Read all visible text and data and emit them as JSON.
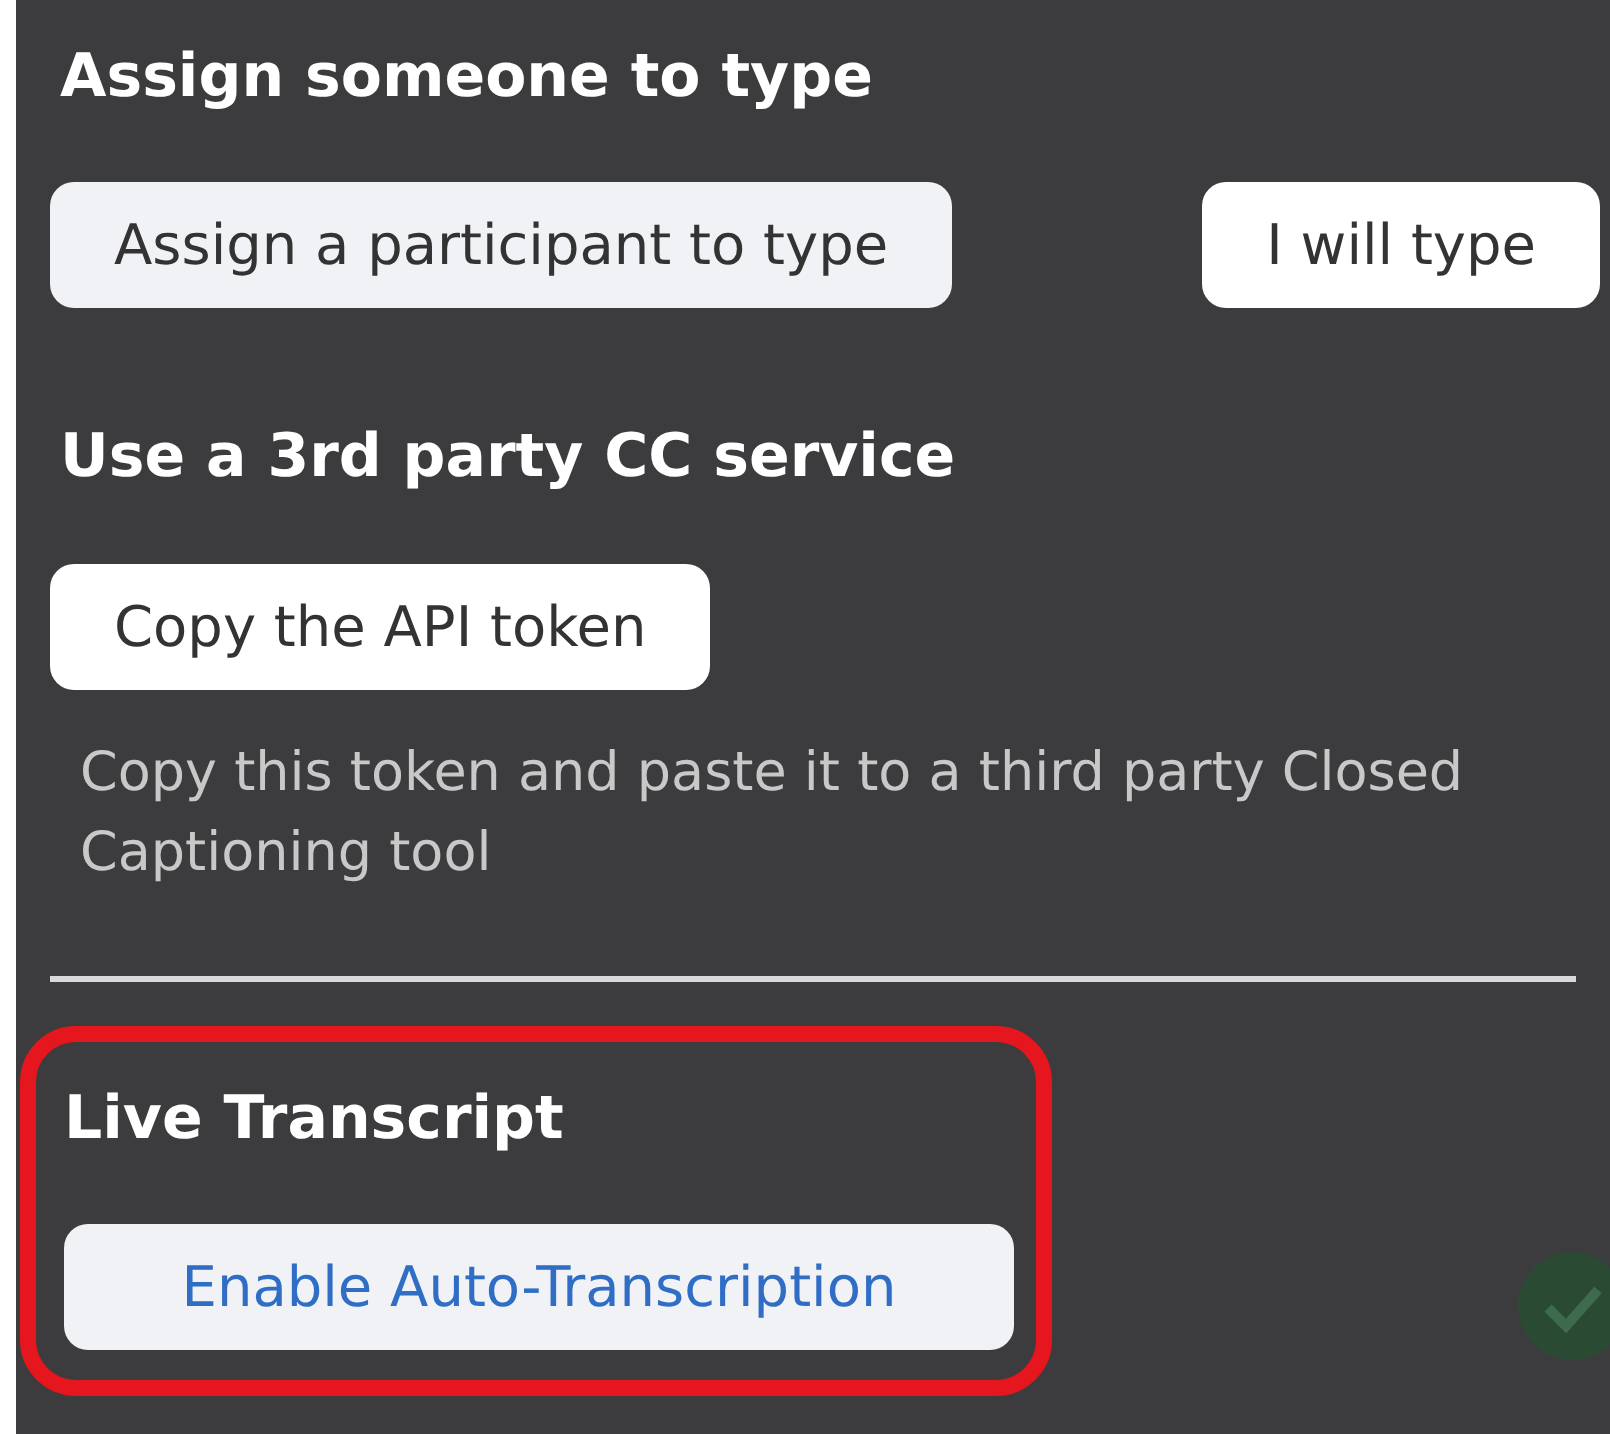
{
  "sections": [
    {
      "kind": "buttons",
      "heading": "Assign someone to type",
      "buttons": [
        {
          "label": "Assign a participant to type",
          "selected": true
        },
        {
          "label": "I will type",
          "selected": false
        }
      ]
    },
    {
      "kind": "token",
      "heading": "Use a 3rd party CC service",
      "buttons": [
        {
          "label": "Copy the API token",
          "selected": false
        }
      ],
      "note": "Copy this token and paste it to a third party Closed Captioning tool"
    },
    {
      "kind": "highlight",
      "heading": "Live Transcript",
      "buttons": [
        {
          "label": "Enable Auto-Transcription",
          "selected": true
        }
      ]
    }
  ]
}
